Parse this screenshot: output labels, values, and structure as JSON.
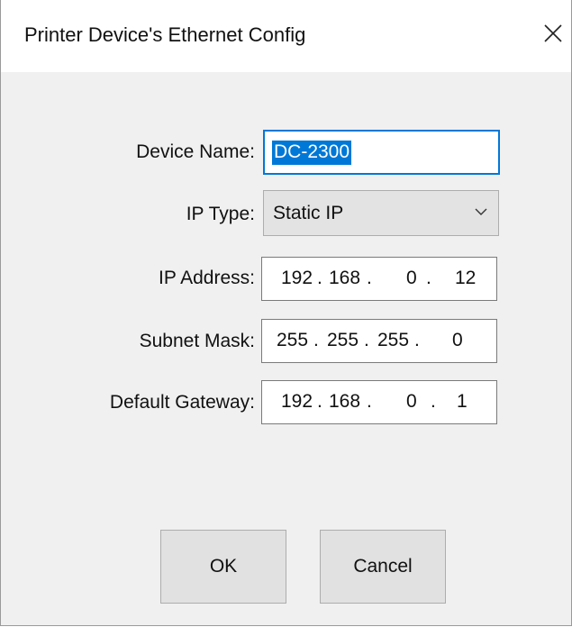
{
  "window": {
    "title": "Printer Device's Ethernet Config"
  },
  "form": {
    "device_name": {
      "label": "Device Name:",
      "value": "DC-2300"
    },
    "ip_type": {
      "label": "IP Type:",
      "value": "Static IP"
    },
    "ip_address": {
      "label": "IP Address:",
      "octets": [
        "192",
        "168",
        "0",
        "12"
      ]
    },
    "subnet_mask": {
      "label": "Subnet Mask:",
      "octets": [
        "255",
        "255",
        "255",
        "0"
      ]
    },
    "default_gateway": {
      "label": "Default Gateway:",
      "octets": [
        "192",
        "168",
        "0",
        "1"
      ]
    },
    "ip_separator": "."
  },
  "buttons": {
    "ok": "OK",
    "cancel": "Cancel"
  },
  "colors": {
    "selection": "#0078d7",
    "dialog_bg": "#f0f0f0",
    "button_bg": "#e1e1e1"
  }
}
